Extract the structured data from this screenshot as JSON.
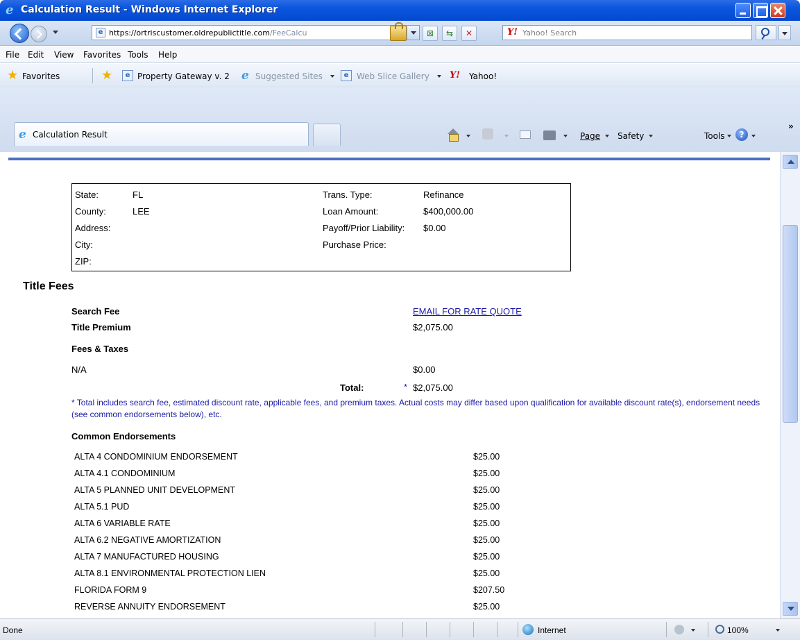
{
  "window": {
    "title": "Calculation Result - Windows Internet Explorer"
  },
  "address_bar": {
    "url_prefix": "https://ortriscustomer.",
    "url_domain": "oldrepublictitle.com",
    "url_rest": "/FeeCalcu",
    "search_placeholder": "Yahoo! Search"
  },
  "menu": [
    "File",
    "Edit",
    "View",
    "Favorites",
    "Tools",
    "Help"
  ],
  "favorites_bar": {
    "favorites_label": "Favorites",
    "items": [
      "Property Gateway v. 2",
      "Suggested Sites",
      "Web Slice Gallery",
      "Yahoo!"
    ]
  },
  "tab": {
    "label": "Calculation Result"
  },
  "command_bar": {
    "page": "Page",
    "safety": "Safety",
    "tools": "Tools"
  },
  "property_info": {
    "state_label": "State:",
    "state_value": "FL",
    "county_label": "County:",
    "county_value": "LEE",
    "address_label": "Address:",
    "city_label": "City:",
    "zip_label": "ZIP:",
    "trans_type_label": "Trans. Type:",
    "trans_type_value": "Refinance",
    "loan_amount_label": "Loan Amount:",
    "loan_amount_value": "$400,000.00",
    "payoff_label": "Payoff/Prior Liability:",
    "payoff_value": "$0.00",
    "purchase_price_label": "Purchase Price:"
  },
  "title_fees": {
    "heading": "Title Fees",
    "search_fee_label": "Search Fee",
    "search_fee_link": "EMAIL FOR RATE QUOTE",
    "title_premium_label": "Title Premium",
    "title_premium_value": "$2,075.00",
    "fees_taxes_label": "Fees & Taxes",
    "na_label": "N/A",
    "na_value": "$0.00",
    "total_label": "Total:",
    "total_marker": "*",
    "total_value": "$2,075.00",
    "note": "* Total includes search fee, estimated discount rate, applicable fees, and premium taxes. Actual costs may differ based upon qualification for available discount rate(s), endorsement needs (see common endorsements below), etc."
  },
  "endorsements": {
    "heading": "Common Endorsements",
    "items": [
      {
        "name": "ALTA 4 CONDOMINIUM ENDORSEMENT",
        "amount": "$25.00"
      },
      {
        "name": "ALTA 4.1 CONDOMINIUM",
        "amount": "$25.00"
      },
      {
        "name": "ALTA 5 PLANNED UNIT DEVELOPMENT",
        "amount": "$25.00"
      },
      {
        "name": "ALTA 5.1 PUD",
        "amount": "$25.00"
      },
      {
        "name": "ALTA 6 VARIABLE RATE",
        "amount": "$25.00"
      },
      {
        "name": "ALTA 6.2 NEGATIVE AMORTIZATION",
        "amount": "$25.00"
      },
      {
        "name": "ALTA 7 MANUFACTURED HOUSING",
        "amount": "$25.00"
      },
      {
        "name": "ALTA 8.1 ENVIRONMENTAL PROTECTION LIEN",
        "amount": "$25.00"
      },
      {
        "name": "FLORIDA FORM 9",
        "amount": "$207.50"
      },
      {
        "name": "REVERSE ANNUITY ENDORSEMENT",
        "amount": "$25.00"
      }
    ]
  },
  "status_bar": {
    "status": "Done",
    "zone": "Internet",
    "zoom": "100%"
  }
}
